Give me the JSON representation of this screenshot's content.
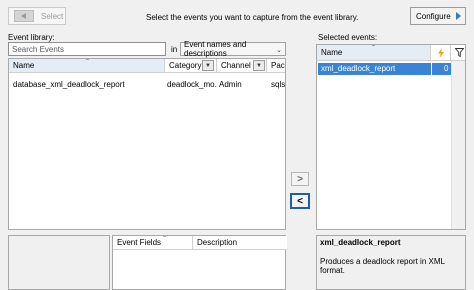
{
  "toolbar": {
    "select_label": "Select",
    "instruction": "Select the events you want to capture from the event library.",
    "configure_label": "Configure"
  },
  "library": {
    "label": "Event library:",
    "search_placeholder": "Search Events",
    "in_label": "in",
    "scope_value": "Event names and descriptions",
    "columns": [
      "Name",
      "Category",
      "Channel",
      "Package"
    ],
    "columns_display": [
      "Name",
      "Category",
      "Channel",
      "Pack"
    ],
    "rows": [
      {
        "name": "database_xml_deadlock_report",
        "category": "deadlock_mo...",
        "channel": "Admin",
        "package": "sqlse"
      }
    ]
  },
  "transfer": {
    "add_label": ">",
    "remove_label": "<"
  },
  "selected": {
    "label": "Selected events:",
    "columns": [
      "Name"
    ],
    "rows": [
      {
        "name": "xml_deadlock_report",
        "count": "0"
      }
    ]
  },
  "fields": {
    "columns": [
      "Event Fields",
      "Description"
    ]
  },
  "description": {
    "title": "xml_deadlock_report",
    "text": "Produces a deadlock report in XML format."
  },
  "colors": {
    "selection": "#3a84d7",
    "accent": "#1e5ea8",
    "lightning": "#e3a21a"
  },
  "icons": [
    "back-arrow-icon",
    "forward-arrow-icon",
    "lightning-icon",
    "filter-icon",
    "dropdown-chevron-icon",
    "sort-arrow-icon"
  ]
}
